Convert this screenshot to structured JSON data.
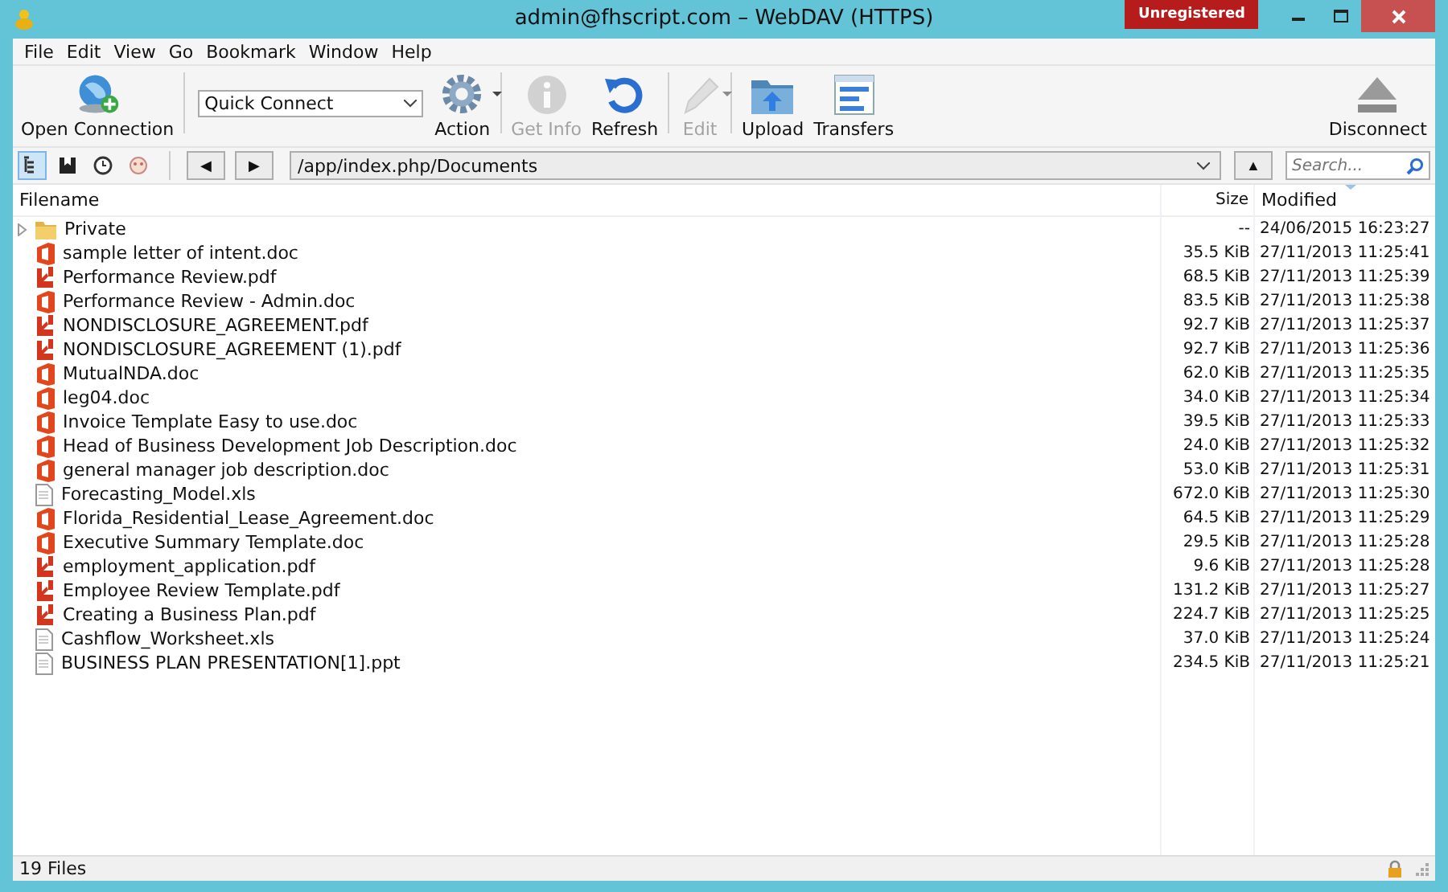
{
  "window": {
    "title": "admin@fhscript.com – WebDAV (HTTPS)",
    "badge": "Unregistered"
  },
  "menu": [
    "File",
    "Edit",
    "View",
    "Go",
    "Bookmark",
    "Window",
    "Help"
  ],
  "toolbar": [
    {
      "kind": "open",
      "label": "Open Connection",
      "disabled": false
    },
    {
      "kind": "quick",
      "placeholder": "Quick Connect"
    },
    {
      "kind": "action",
      "label": "Action",
      "disabled": false
    },
    {
      "kind": "info",
      "label": "Get Info",
      "disabled": true
    },
    {
      "kind": "refresh",
      "label": "Refresh",
      "disabled": false
    },
    {
      "kind": "edit",
      "label": "Edit",
      "disabled": true
    },
    {
      "kind": "upload",
      "label": "Upload",
      "disabled": false
    },
    {
      "kind": "transfers",
      "label": "Transfers",
      "disabled": false
    },
    {
      "kind": "disconnect",
      "label": "Disconnect",
      "disabled": false
    }
  ],
  "views": [
    {
      "kind": "browser",
      "selected": true
    },
    {
      "kind": "bookmarks",
      "selected": false
    },
    {
      "kind": "history",
      "selected": false
    },
    {
      "kind": "bonjour",
      "selected": false
    }
  ],
  "nav": {
    "back": "◀",
    "forward": "▶",
    "path": "/app/index.php/Documents",
    "up": "▲",
    "search_placeholder": "Search..."
  },
  "table": {
    "columns": [
      "Filename",
      "Size",
      "Modified"
    ],
    "rows": [
      {
        "kind": "folder",
        "name": "Private",
        "size": "--",
        "modified": "24/06/2015 16:23:27",
        "expanded": false
      },
      {
        "kind": "doc",
        "name": "sample letter of intent.doc",
        "size": "35.5 KiB",
        "modified": "27/11/2013 11:25:41"
      },
      {
        "kind": "pdf",
        "name": "Performance Review.pdf",
        "size": "68.5 KiB",
        "modified": "27/11/2013 11:25:39"
      },
      {
        "kind": "doc",
        "name": "Performance Review - Admin.doc",
        "size": "83.5 KiB",
        "modified": "27/11/2013 11:25:38"
      },
      {
        "kind": "pdf",
        "name": "NONDISCLOSURE_AGREEMENT.pdf",
        "size": "92.7 KiB",
        "modified": "27/11/2013 11:25:37"
      },
      {
        "kind": "pdf",
        "name": "NONDISCLOSURE_AGREEMENT (1).pdf",
        "size": "92.7 KiB",
        "modified": "27/11/2013 11:25:36"
      },
      {
        "kind": "doc",
        "name": "MutualNDA.doc",
        "size": "62.0 KiB",
        "modified": "27/11/2013 11:25:35"
      },
      {
        "kind": "doc",
        "name": "leg04.doc",
        "size": "34.0 KiB",
        "modified": "27/11/2013 11:25:34"
      },
      {
        "kind": "doc",
        "name": "Invoice Template Easy to use.doc",
        "size": "39.5 KiB",
        "modified": "27/11/2013 11:25:33"
      },
      {
        "kind": "doc",
        "name": "Head of Business Development Job Description.doc",
        "size": "24.0 KiB",
        "modified": "27/11/2013 11:25:32"
      },
      {
        "kind": "doc",
        "name": "general manager job description.doc",
        "size": "53.0 KiB",
        "modified": "27/11/2013 11:25:31"
      },
      {
        "kind": "file",
        "name": "Forecasting_Model.xls",
        "size": "672.0 KiB",
        "modified": "27/11/2013 11:25:30"
      },
      {
        "kind": "doc",
        "name": "Florida_Residential_Lease_Agreement.doc",
        "size": "64.5 KiB",
        "modified": "27/11/2013 11:25:29"
      },
      {
        "kind": "doc",
        "name": "Executive Summary Template.doc",
        "size": "29.5 KiB",
        "modified": "27/11/2013 11:25:28"
      },
      {
        "kind": "pdf",
        "name": "employment_application.pdf",
        "size": "9.6 KiB",
        "modified": "27/11/2013 11:25:28"
      },
      {
        "kind": "pdf",
        "name": "Employee Review Template.pdf",
        "size": "131.2 KiB",
        "modified": "27/11/2013 11:25:27"
      },
      {
        "kind": "pdf",
        "name": "Creating a Business Plan.pdf",
        "size": "224.7 KiB",
        "modified": "27/11/2013 11:25:25"
      },
      {
        "kind": "file",
        "name": "Cashflow_Worksheet.xls",
        "size": "37.0 KiB",
        "modified": "27/11/2013 11:25:24"
      },
      {
        "kind": "file",
        "name": "BUSINESS PLAN PRESENTATION[1].ppt",
        "size": "234.5 KiB",
        "modified": "27/11/2013 11:25:21"
      }
    ]
  },
  "status_bar": {
    "text": "19 Files"
  }
}
